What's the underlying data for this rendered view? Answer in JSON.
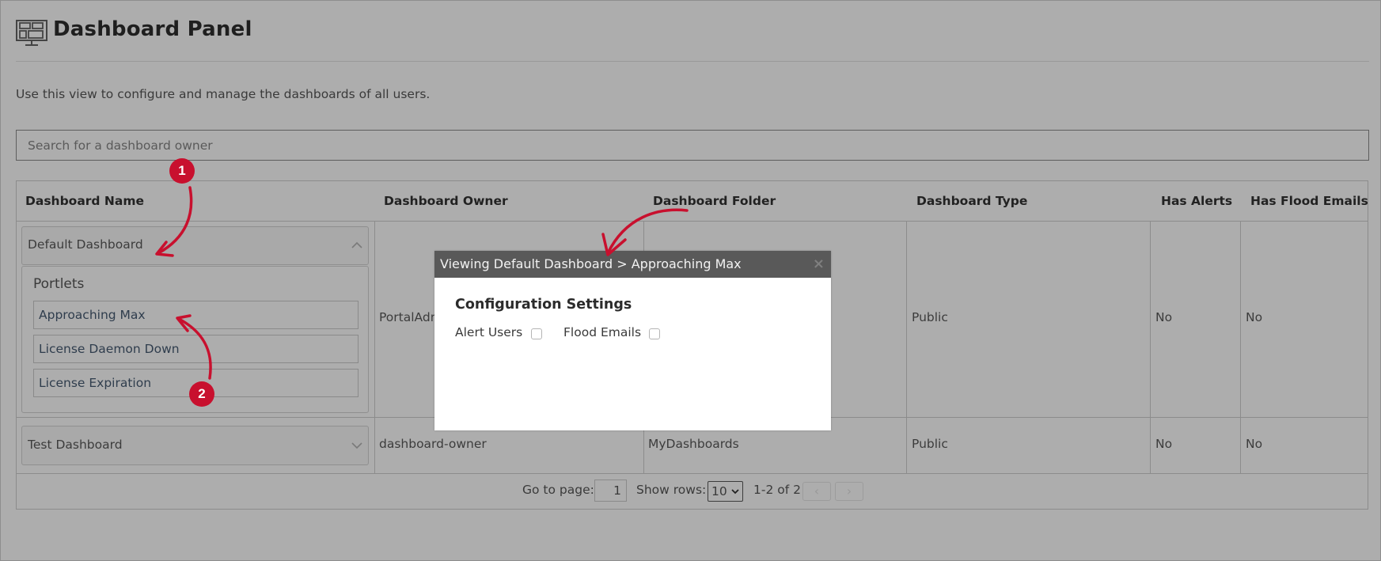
{
  "page": {
    "title": "Dashboard Panel",
    "title_icon": "dashboard-monitor-icon",
    "description": "Use this view to configure and manage the dashboards of all users."
  },
  "search": {
    "placeholder": "Search for a dashboard owner",
    "value": ""
  },
  "table": {
    "columns": [
      "Dashboard Name",
      "Dashboard Owner",
      "Dashboard Folder",
      "Dashboard Type",
      "Has Alerts",
      "Has Flood Emails"
    ],
    "rows": [
      {
        "name": "Default Dashboard",
        "expanded": true,
        "toggle_icon": "chevron-up-icon",
        "portlets_label": "Portlets",
        "portlets": [
          "Approaching Max",
          "License Daemon Down",
          "License Expiration"
        ],
        "owner": "PortalAdmin",
        "folder": "",
        "type": "Public",
        "has_alerts": "No",
        "has_flood_emails": "No"
      },
      {
        "name": "Test Dashboard",
        "expanded": false,
        "toggle_icon": "chevron-down-icon",
        "owner": "dashboard-owner",
        "folder": "MyDashboards",
        "type": "Public",
        "has_alerts": "No",
        "has_flood_emails": "No"
      }
    ]
  },
  "pagination": {
    "goto_label": "Go to page:",
    "page": "1",
    "rows_label": "Show rows:",
    "rows_value": "10",
    "range": "1-2 of 2",
    "prev_icon": "chevron-left-icon",
    "next_icon": "chevron-right-icon",
    "prev_glyph": "‹",
    "next_glyph": "›"
  },
  "modal": {
    "title": "Viewing Default Dashboard > Approaching Max",
    "close_glyph": "×",
    "section_title": "Configuration Settings",
    "alert_users_label": "Alert Users",
    "alert_users_checked": false,
    "flood_emails_label": "Flood Emails",
    "flood_emails_checked": false
  },
  "annotations": {
    "color": "#c8102e",
    "badges": [
      "1",
      "2"
    ]
  }
}
